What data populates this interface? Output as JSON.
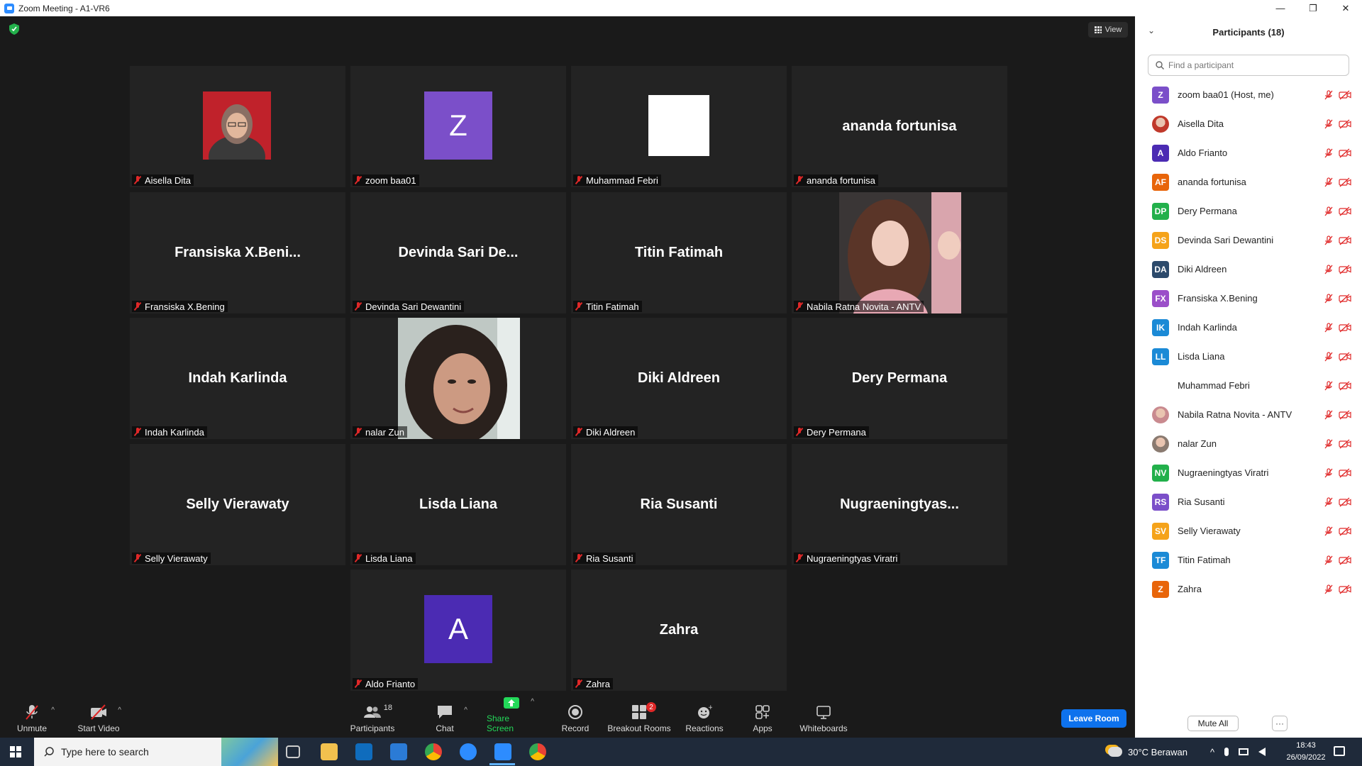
{
  "window": {
    "title": "Zoom Meeting - A1-VR6",
    "controls": [
      "—",
      "❐",
      "✕"
    ]
  },
  "view_button": "View",
  "tiles": [
    {
      "label": "Aisella Dita",
      "big": ""
    },
    {
      "label": "zoom baa01",
      "big": "",
      "avatar_letter": "Z"
    },
    {
      "label": "Muhammad Febri",
      "big": ""
    },
    {
      "label": "ananda fortunisa",
      "big": "ananda fortunisa"
    },
    {
      "label": "Fransiska X.Bening",
      "big": "Fransiska  X.Beni..."
    },
    {
      "label": "Devinda Sari Dewantini",
      "big": "Devinda  Sari  De..."
    },
    {
      "label": "Titin Fatimah",
      "big": "Titin Fatimah"
    },
    {
      "label": "Nabila Ratna Novita - ANTV",
      "big": ""
    },
    {
      "label": "Indah Karlinda",
      "big": "Indah Karlinda"
    },
    {
      "label": "nalar Zun",
      "big": ""
    },
    {
      "label": "Diki Aldreen",
      "big": "Diki Aldreen"
    },
    {
      "label": "Dery Permana",
      "big": "Dery Permana"
    },
    {
      "label": "Selly Vierawaty",
      "big": "Selly Vierawaty"
    },
    {
      "label": "Lisda Liana",
      "big": "Lisda Liana"
    },
    {
      "label": "Ria Susanti",
      "big": "Ria Susanti"
    },
    {
      "label": "Nugraeningtyas Viratri",
      "big": "Nugraeningtyas..."
    },
    {
      "label": "Aldo Frianto",
      "big": "",
      "avatar_letter": "A"
    },
    {
      "label": "Zahra",
      "big": "Zahra"
    }
  ],
  "toolbar": {
    "unmute": "Unmute",
    "start_video": "Start Video",
    "participants": "Participants",
    "participants_count": "18",
    "chat": "Chat",
    "share_screen": "Share Screen",
    "record": "Record",
    "breakout_rooms": "Breakout Rooms",
    "breakout_badge": "2",
    "reactions": "Reactions",
    "apps": "Apps",
    "whiteboards": "Whiteboards",
    "leave": "Leave Room"
  },
  "panel": {
    "title": "Participants (18)",
    "search_placeholder": "Find a participant",
    "participants": [
      {
        "initials": "Z",
        "name": "zoom baa01 (Host, me)",
        "color": "#7b4fc9"
      },
      {
        "initials": "",
        "name": "Aisella Dita",
        "color": "#c0392b"
      },
      {
        "initials": "A",
        "name": "Aldo Frianto",
        "color": "#4b2bb3"
      },
      {
        "initials": "AF",
        "name": "ananda fortunisa",
        "color": "#e8650a"
      },
      {
        "initials": "DP",
        "name": "Dery Permana",
        "color": "#22b04b"
      },
      {
        "initials": "DS",
        "name": "Devinda Sari Dewantini",
        "color": "#f5a31a"
      },
      {
        "initials": "DA",
        "name": "Diki Aldreen",
        "color": "#2c4a6b"
      },
      {
        "initials": "FX",
        "name": "Fransiska X.Bening",
        "color": "#9b4fc9"
      },
      {
        "initials": "IK",
        "name": "Indah Karlinda",
        "color": "#1b8ad6"
      },
      {
        "initials": "LL",
        "name": "Lisda Liana",
        "color": "#1b8ad6"
      },
      {
        "initials": "",
        "name": "Muhammad Febri",
        "color": "#ffffff"
      },
      {
        "initials": "",
        "name": "Nabila Ratna Novita - ANTV",
        "color": "#c98a8f"
      },
      {
        "initials": "",
        "name": "nalar Zun",
        "color": "#8a7a70"
      },
      {
        "initials": "NV",
        "name": "Nugraeningtyas Viratri",
        "color": "#22b04b"
      },
      {
        "initials": "RS",
        "name": "Ria Susanti",
        "color": "#7b4fc9"
      },
      {
        "initials": "SV",
        "name": "Selly Vierawaty",
        "color": "#f5a31a"
      },
      {
        "initials": "TF",
        "name": "Titin Fatimah",
        "color": "#1b8ad6"
      },
      {
        "initials": "Z",
        "name": "Zahra",
        "color": "#e8650a"
      }
    ],
    "mute_all": "Mute All",
    "more": "···"
  },
  "taskbar": {
    "search_placeholder": "Type here to search",
    "weather": "30°C  Berawan",
    "time": "18:43",
    "date": "26/09/2022"
  }
}
